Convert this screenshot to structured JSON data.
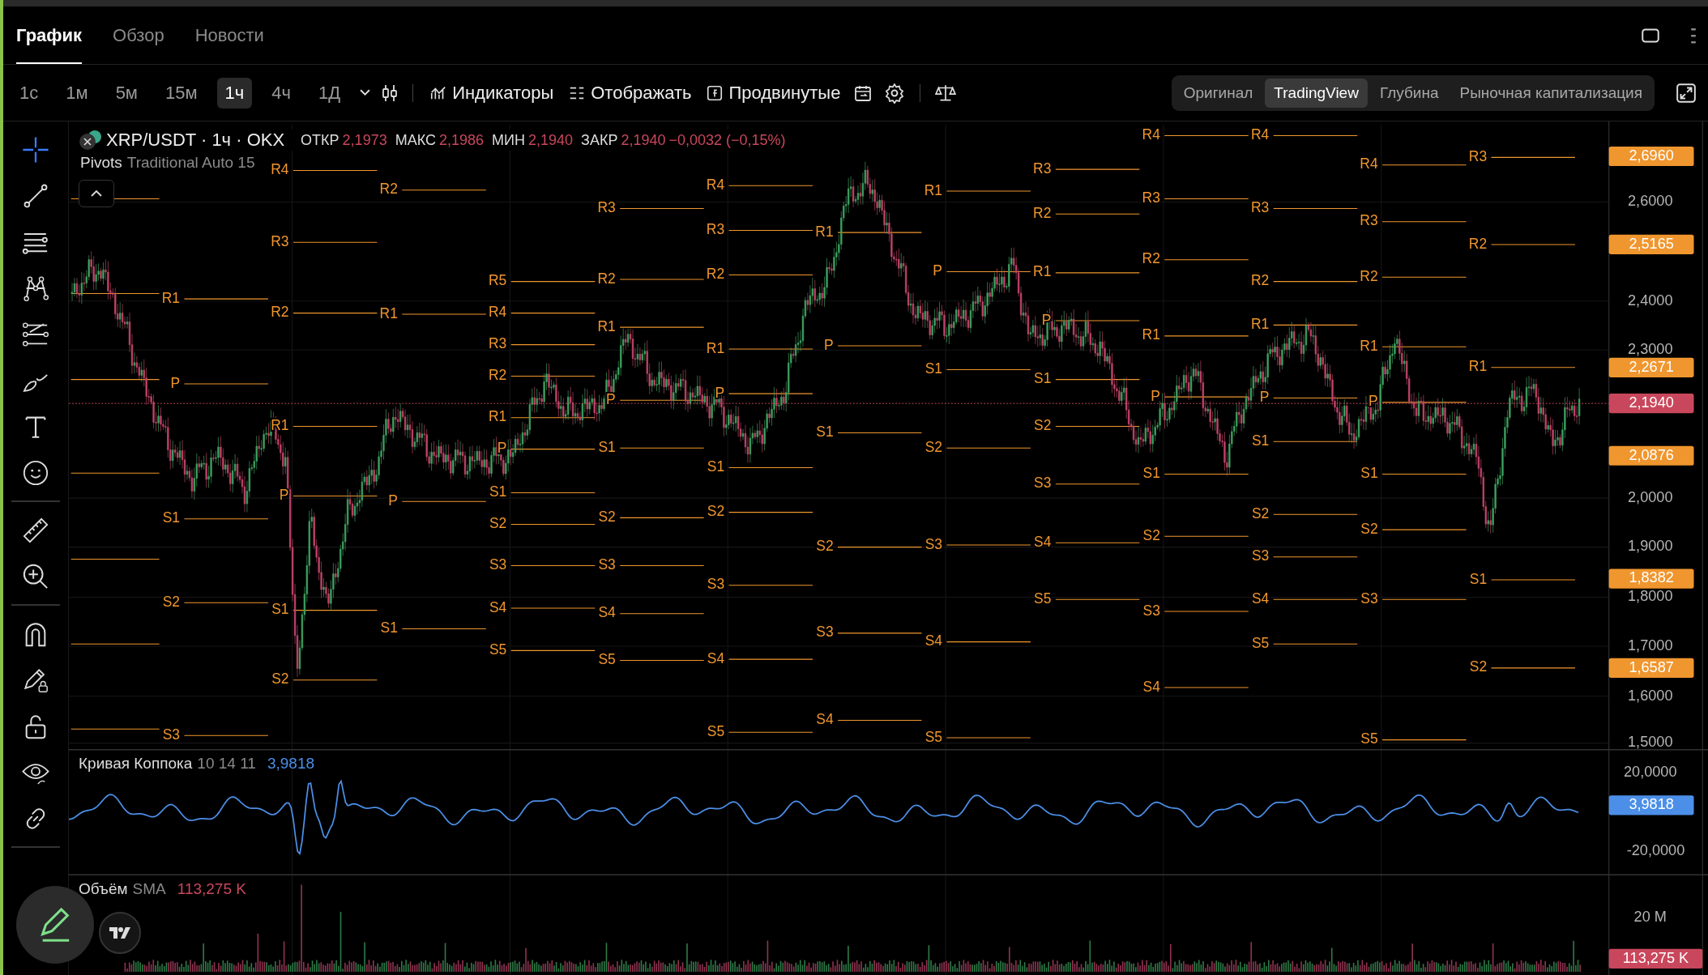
{
  "tabs": [
    {
      "label": "График",
      "selected": true
    },
    {
      "label": "Обзор",
      "selected": false
    },
    {
      "label": "Новости",
      "selected": false
    }
  ],
  "intervals": [
    {
      "label": "1с",
      "selected": false
    },
    {
      "label": "1м",
      "selected": false
    },
    {
      "label": "5м",
      "selected": false
    },
    {
      "label": "15м",
      "selected": false
    },
    {
      "label": "1ч",
      "selected": true
    },
    {
      "label": "4ч",
      "selected": false
    },
    {
      "label": "1Д",
      "selected": false
    }
  ],
  "toolbar_buttons": [
    {
      "label": "Индикаторы",
      "kind": "indicators"
    },
    {
      "label": "Отображать",
      "kind": "display"
    },
    {
      "label": "Продвинутые",
      "kind": "advanced"
    }
  ],
  "view_modes": [
    {
      "label": "Оригинал",
      "selected": false
    },
    {
      "label": "TradingView",
      "selected": true
    },
    {
      "label": "Глубина",
      "selected": false
    },
    {
      "label": "Рыночная капитализация",
      "selected": false
    }
  ],
  "legend": {
    "symbol": "XRP/USDT · 1ч · OKX",
    "ohlc": [
      {
        "label": "ОТКР",
        "value": "2,1973"
      },
      {
        "label": "МАКС",
        "value": "2,1986"
      },
      {
        "label": "МИН",
        "value": "2,1940"
      },
      {
        "label": "ЗАКР",
        "value": "2,1940"
      }
    ],
    "change": "−0,0032 (−0,15%)",
    "indicator_name": "Pivots",
    "indicator_params": "Traditional Auto 15"
  },
  "pivot_periods": [
    {
      "levels": [
        "R1",
        "P",
        "S1",
        "S2",
        "S3"
      ]
    },
    {
      "levels": [
        "R4",
        "R3",
        "R2",
        "R1",
        "P",
        "S1",
        "S2"
      ]
    },
    {
      "levels": [
        "R2",
        "R1",
        "P",
        "S1"
      ]
    },
    {
      "levels": [
        "R5",
        "R4",
        "R3",
        "R2",
        "R1",
        "P",
        "S1",
        "S2",
        "S3",
        "S4",
        "S5"
      ]
    },
    {
      "levels": [
        "R3",
        "R2",
        "R1",
        "P",
        "S1",
        "S2",
        "S3",
        "S4",
        "S5"
      ]
    },
    {
      "levels": [
        "R4",
        "R3",
        "R2",
        "R1",
        "P",
        "S1",
        "S2",
        "S3",
        "S4",
        "S5"
      ]
    },
    {
      "levels": [
        "R1",
        "P",
        "S1",
        "S2",
        "S3",
        "S4"
      ]
    },
    {
      "levels": [
        "R1",
        "P",
        "S1",
        "S2",
        "S3",
        "S4",
        "S5"
      ]
    },
    {
      "levels": [
        "R3",
        "R2",
        "R1",
        "P",
        "S1",
        "S2",
        "S3",
        "S4",
        "S5"
      ]
    },
    {
      "levels": [
        "R4",
        "R3",
        "R2",
        "R1",
        "P",
        "S1",
        "S2",
        "S3",
        "S4"
      ]
    },
    {
      "levels": [
        "R4",
        "R3",
        "R2",
        "R1",
        "P",
        "S1",
        "S2",
        "S3",
        "S4",
        "S5"
      ]
    },
    {
      "levels": [
        "R4",
        "R3",
        "R2",
        "R1",
        "P",
        "S1",
        "S2",
        "S3",
        "S5"
      ]
    },
    {
      "levels": [
        "R3",
        "R2",
        "R1",
        "S1",
        "S2"
      ]
    }
  ],
  "price_axis": [
    "2,6000",
    "2,4000",
    "2,3000",
    "2,0000",
    "1,9000",
    "1,8000",
    "1,7000",
    "1,6000",
    "1,5000"
  ],
  "price_tags": [
    {
      "value": "2,6960",
      "color": "#f0962e"
    },
    {
      "value": "2,5165",
      "color": "#f0962e"
    },
    {
      "value": "2,2671",
      "color": "#f0962e"
    },
    {
      "value": "2,1940",
      "color": "#c9475c"
    },
    {
      "value": "2,0876",
      "color": "#f0962e"
    },
    {
      "value": "1,8382",
      "color": "#f0962e"
    },
    {
      "value": "1,6587",
      "color": "#f0962e"
    }
  ],
  "oscillator": {
    "name": "Кривая Коппока",
    "params": "10 14 11",
    "value": "3,9818",
    "axis": [
      "20,0000",
      "-20,0000"
    ],
    "tag": {
      "value": "3,9818",
      "color": "#4c8fe8"
    }
  },
  "volume": {
    "name": "Объём",
    "params": "SMA",
    "value": "113,275 K",
    "axis": [
      "20 M"
    ],
    "tag": {
      "value": "113,275 K",
      "color": "#c9475c"
    }
  }
}
